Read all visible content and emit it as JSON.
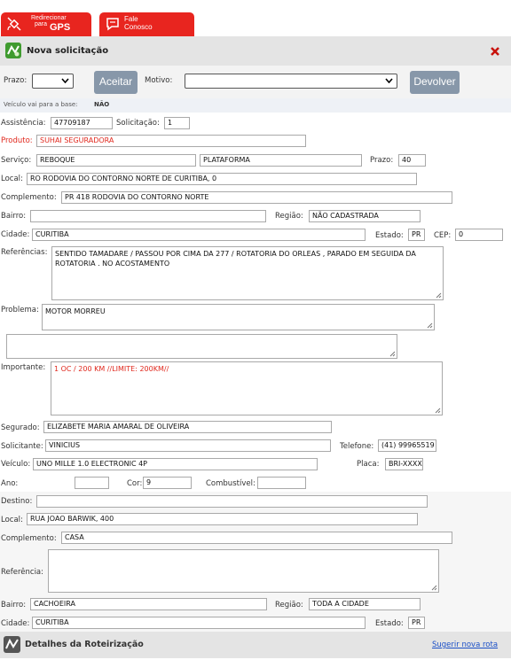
{
  "top_buttons": {
    "gps": {
      "line1": "Redirecionar",
      "line2": "para",
      "line3": "GPS"
    },
    "fale": {
      "line1": "Fale",
      "line2": "Conosco"
    }
  },
  "header": {
    "title": "Nova solicitação",
    "close_icon": "close-icon"
  },
  "toolbar": {
    "prazo_label": "Prazo:",
    "prazo_value": "",
    "aceitar_label": "Aceitar",
    "motivo_label": "Motivo:",
    "motivo_value": "",
    "devolver_label": "Devolver"
  },
  "base_info": {
    "label": "Veículo vai para a base:",
    "value": "NÃO"
  },
  "form": {
    "assistencia_label": "Assistência:",
    "assistencia": "47709187",
    "solicitacao_label": "Solicitação:",
    "solicitacao": "1",
    "produto_label": "Produto:",
    "produto": "SUHAI SEGURADORA",
    "servico_label": "Serviço:",
    "servico": "REBOQUE",
    "servico2": "PLATAFORMA",
    "prazo_label": "Prazo:",
    "prazo": "40",
    "local_label": "Local:",
    "local": "RO RODOVIA DO CONTORNO NORTE DE CURITIBA, 0",
    "complemento_label": "Complemento:",
    "complemento": "PR 418 RODOVIA DO CONTORNO NORTE",
    "bairro_label": "Bairro:",
    "bairro": "",
    "regiao_label": "Região:",
    "regiao": "NÃO CADASTRADA",
    "cidade_label": "Cidade:",
    "cidade": "CURITIBA",
    "estado_label": "Estado:",
    "estado": "PR",
    "cep_label": "CEP:",
    "cep": "0",
    "referencias_label": "Referências:",
    "referencias": "SENTIDO TAMADARE / PASSOU POR CIMA DA 277 / ROTATORIA DO ORLEAS , PARADO EM SEGUIDA DA ROTATORIA . NO ACOSTAMENTO",
    "problema_label": "Problema:",
    "problema": "MOTOR MORREU",
    "extra": "",
    "importante_label": "Importante:",
    "importante": "1 OC / 200 KM //LIMITE: 200KM//",
    "segurado_label": "Segurado:",
    "segurado": "ELIZABETE MARIA AMARAL DE OLIVEIRA",
    "solicitante_label": "Solicitante:",
    "solicitante": "VINICIUS",
    "telefone_label": "Telefone:",
    "telefone": "(41) 99965519",
    "veiculo_label": "Veículo:",
    "veiculo": "UNO MILLE 1.0 ELECTRONIC 4P",
    "placa_label": "Placa:",
    "placa": "BRI-XXXX",
    "ano_label": "Ano:",
    "ano": "",
    "cor_label": "Cor:",
    "cor": "9",
    "combustivel_label": "Combustível:",
    "combustivel": "",
    "destino_label": "Destino:",
    "destino": "",
    "dest_local_label": "Local:",
    "dest_local": "RUA JOAO BARWIK, 400",
    "dest_complemento_label": "Complemento:",
    "dest_complemento": "CASA",
    "dest_referencia_label": "Referência:",
    "dest_referencia": "",
    "dest_bairro_label": "Bairro:",
    "dest_bairro": "CACHOEIRA",
    "dest_regiao_label": "Região:",
    "dest_regiao": "TODA A CIDADE",
    "dest_cidade_label": "Cidade:",
    "dest_cidade": "CURITIBA",
    "dest_estado_label": "Estado:",
    "dest_estado": "PR"
  },
  "footer": {
    "title": "Detalhes da Roteirização",
    "link": "Sugerir nova rota"
  },
  "colors": {
    "brand_red": "#e8251f",
    "button_gray": "#8797a9",
    "header_gray": "#e4e4e4",
    "link_blue": "#1a4fc7"
  }
}
